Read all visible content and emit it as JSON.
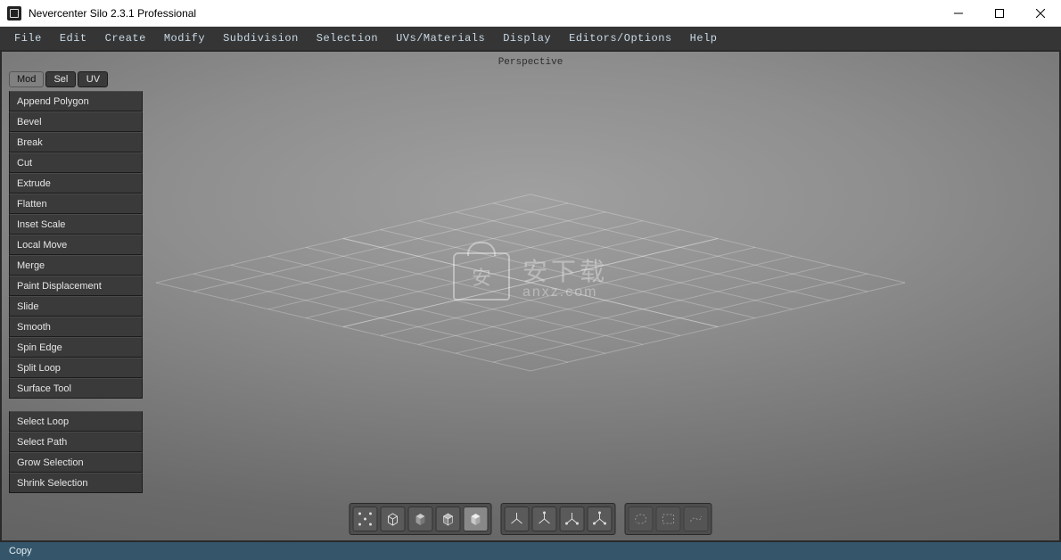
{
  "titlebar": {
    "title": "Nevercenter Silo 2.3.1 Professional"
  },
  "menubar": {
    "items": [
      "File",
      "Edit",
      "Create",
      "Modify",
      "Subdivision",
      "Selection",
      "UVs/Materials",
      "Display",
      "Editors/Options",
      "Help"
    ]
  },
  "viewport": {
    "label": "Perspective"
  },
  "watermark": {
    "cn": "安下载",
    "domain": "anxz.com"
  },
  "sidepanel": {
    "tabs": [
      {
        "label": "Mod",
        "active": true
      },
      {
        "label": "Sel",
        "active": false
      },
      {
        "label": "UV",
        "active": false
      }
    ],
    "group1": [
      "Append Polygon",
      "Bevel",
      "Break",
      "Cut",
      "Extrude",
      "Flatten",
      "Inset Scale",
      "Local Move",
      "Merge",
      "Paint Displacement",
      "Slide",
      "Smooth",
      "Spin Edge",
      "Split Loop",
      "Surface Tool"
    ],
    "group2": [
      "Select Loop",
      "Select Path",
      "Grow Selection",
      "Shrink Selection"
    ]
  },
  "bottom_toolbar": {
    "display_modes": [
      {
        "name": "vertex-mode-icon"
      },
      {
        "name": "cube-outline-icon"
      },
      {
        "name": "cube-shaded-icon"
      },
      {
        "name": "cube-wire-shaded-icon"
      },
      {
        "name": "cube-solid-icon",
        "active": true
      }
    ],
    "component_modes": [
      {
        "name": "axis-object-icon"
      },
      {
        "name": "axis-vertex-icon"
      },
      {
        "name": "axis-edge-icon"
      },
      {
        "name": "axis-face-icon"
      }
    ],
    "selection_modes": [
      {
        "name": "select-lasso-icon"
      },
      {
        "name": "select-box-icon"
      },
      {
        "name": "select-paint-icon"
      }
    ]
  },
  "statusbar": {
    "text": "Copy"
  }
}
